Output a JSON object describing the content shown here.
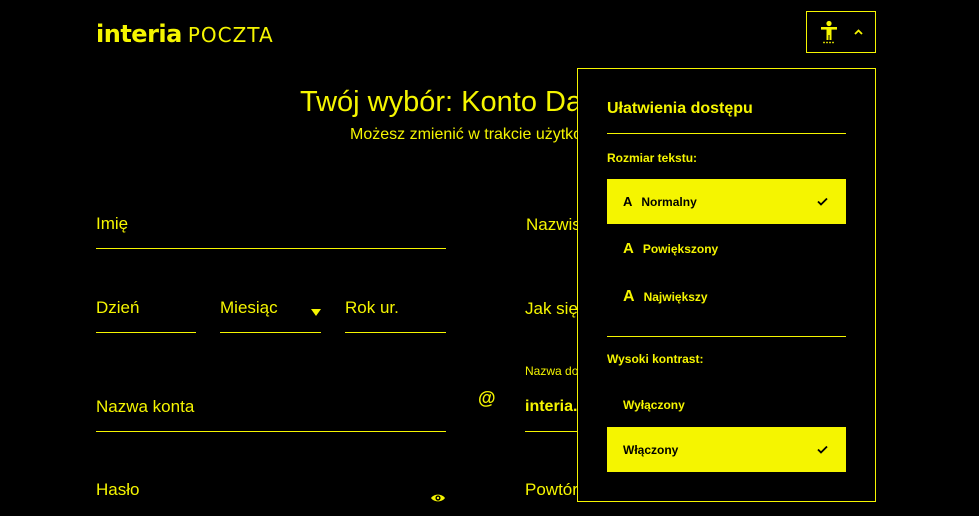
{
  "header": {
    "logo_brand": "interia",
    "logo_product": "POCZTA"
  },
  "main": {
    "headline": "Twój wybór: Konto Da",
    "subline": "Możesz zmienić w trakcie użytko"
  },
  "form": {
    "first_name_label": "Imię",
    "last_name_label": "Nazwis",
    "day_label": "Dzień",
    "month_label": "Miesiąc",
    "year_label": "Rok ur.",
    "gender_label": "Jak się",
    "account_name_label": "Nazwa konta",
    "at_sign": "@",
    "domain_label": "Nazwa do",
    "domain_value": "interia.",
    "password_label": "Hasło",
    "repeat_password_label": "Powtór"
  },
  "a11y_panel": {
    "title": "Ułatwienia dostępu",
    "text_size_label": "Rozmiar tekstu:",
    "size_options": [
      {
        "glyph": "A",
        "label": "Normalny",
        "selected": true
      },
      {
        "glyph": "A",
        "label": "Powiększony",
        "selected": false
      },
      {
        "glyph": "A",
        "label": "Największy",
        "selected": false
      }
    ],
    "contrast_label": "Wysoki kontrast:",
    "contrast_options": [
      {
        "label": "Wyłączony",
        "selected": false
      },
      {
        "label": "Włączony",
        "selected": true
      }
    ]
  },
  "colors": {
    "accent": "#f5f500",
    "background": "#000000"
  },
  "icons": {
    "toggle": "accessibility-person-icon",
    "toggle_caret": "chevron-up-icon",
    "password": "eye-icon",
    "selected": "check-icon"
  }
}
